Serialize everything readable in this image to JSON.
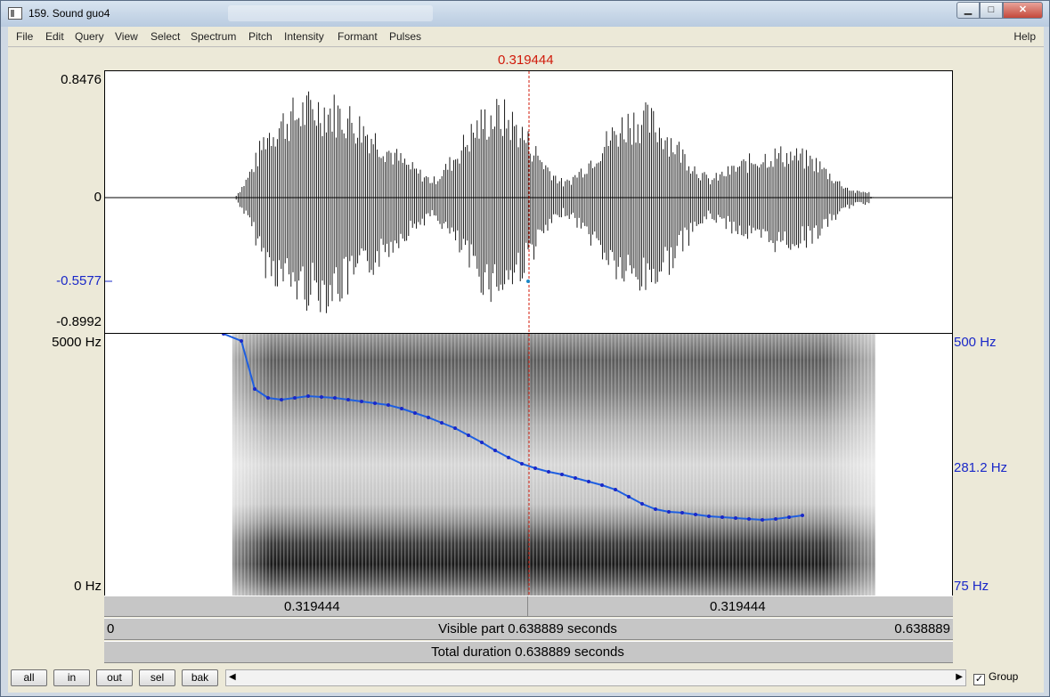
{
  "window": {
    "title": "159. Sound guo4",
    "min_glyph": "▁",
    "max_glyph": "□",
    "close_glyph": "✕"
  },
  "menu": {
    "items": [
      "File",
      "Edit",
      "Query",
      "View",
      "Select",
      "Spectrum",
      "Pitch",
      "Intensity",
      "Formant",
      "Pulses"
    ],
    "help": "Help"
  },
  "cursor": {
    "time_label": "0.319444",
    "color": "#d01a0a"
  },
  "waveform": {
    "max_label": "0.8476",
    "zero_label": "0",
    "cursor_value_label": "-0.5577",
    "min_label": "-0.8992"
  },
  "spectrogram": {
    "top_label": "5000 Hz",
    "bottom_label": "0 Hz"
  },
  "pitch_axis": {
    "top_label": "500 Hz",
    "mid_label": "281.2 Hz",
    "bottom_label": "75 Hz",
    "color": "#1a28c8"
  },
  "bars": {
    "left_part": "0.319444",
    "right_part": "0.319444",
    "visible_start": "0",
    "visible_text": "Visible part 0.638889 seconds",
    "visible_end": "0.638889",
    "total_text": "Total duration 0.638889 seconds"
  },
  "toolbar": {
    "all": "all",
    "in": "in",
    "out": "out",
    "sel": "sel",
    "bak": "bak",
    "scroll_left": "◀",
    "scroll_right": "▶",
    "group_label": "Group",
    "group_checked": true,
    "check_glyph": "✓"
  }
}
